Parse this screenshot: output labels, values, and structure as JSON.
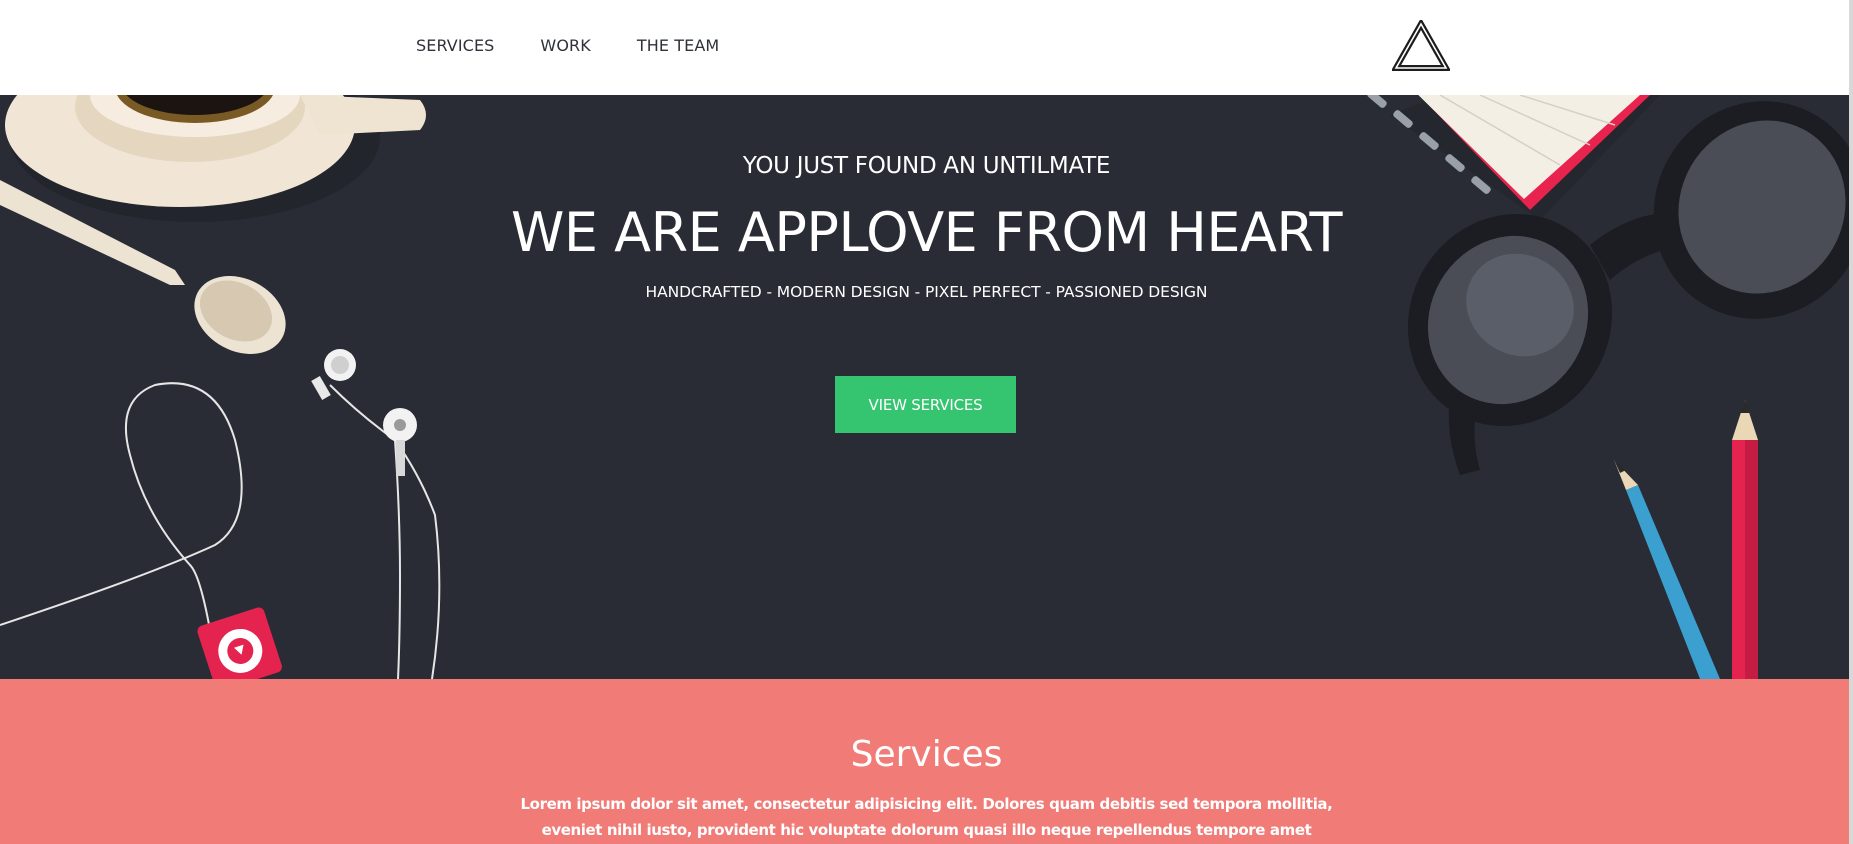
{
  "nav": {
    "links": [
      {
        "label": "SERVICES"
      },
      {
        "label": "WORK"
      },
      {
        "label": "THE TEAM"
      }
    ],
    "logo_icon": "triangle-logo-icon"
  },
  "hero": {
    "eyebrow": "YOU JUST FOUND AN UNTILMATE",
    "title": "WE ARE APPLOVE FROM HEART",
    "tagline": "HANDCRAFTED - MODERN DESIGN - PIXEL PERFECT - PASSIONED DESIGN",
    "cta_label": "VIEW SERVICES"
  },
  "services": {
    "title": "Services",
    "text": "Lorem ipsum dolor sit amet, consectetur adipisicing elit. Dolores quam debitis sed tempora mollitia, eveniet nihil iusto, provident hic voluptate dolorum quasi illo neque repellendus tempore amet consequuntur. Nostrum,"
  },
  "colors": {
    "hero_bg": "#292c35",
    "cta_bg": "#35c46f",
    "services_bg": "#f07b77",
    "nav_text": "#2f3238"
  }
}
